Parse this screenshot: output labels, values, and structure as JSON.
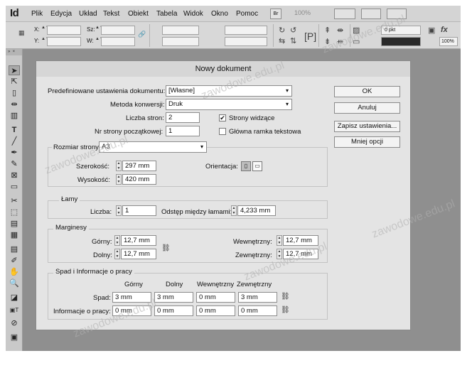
{
  "app": {
    "logo": "Id"
  },
  "menubar": {
    "items": [
      "Plik",
      "Edycja",
      "Układ",
      "Tekst",
      "Obiekt",
      "Tabela",
      "Widok",
      "Okno",
      "Pomoc"
    ],
    "bridge_label": "Br",
    "zoom": "100%"
  },
  "controlbar": {
    "x_label": "X:",
    "y_label": "Y:",
    "w_label": "Sz:",
    "h_label": "W:",
    "stroke_weight": "0 pkt",
    "zoom_pct": "100%"
  },
  "dialog": {
    "title": "Nowy dokument",
    "preset_label": "Predefiniowane ustawienia dokumentu:",
    "preset_value": "[Własne]",
    "intent_label": "Metoda konwersji:",
    "intent_value": "Druk",
    "pages_label": "Liczba stron:",
    "pages_value": "2",
    "start_label": "Nr strony początkowej:",
    "start_value": "1",
    "facing_label": "Strony widzące",
    "facing_checked": true,
    "master_label": "Główna ramka tekstowa",
    "master_checked": false,
    "page_size_label": "Rozmiar strony:",
    "page_size_value": "A3",
    "width_label": "Szerokość:",
    "width_value": "297 mm",
    "height_label": "Wysokość:",
    "height_value": "420 mm",
    "orientation_label": "Orientacja:",
    "columns": {
      "title": "Łamy",
      "number_label": "Liczba:",
      "number_value": "1",
      "gutter_label": "Odstęp między łamami:",
      "gutter_value": "4,233 mm"
    },
    "margins": {
      "title": "Marginesy",
      "top_label": "Górny:",
      "top_value": "12,7 mm",
      "bottom_label": "Dolny:",
      "bottom_value": "12,7 mm",
      "inside_label": "Wewnętrzny:",
      "inside_value": "12,7 mm",
      "outside_label": "Zewnętrzny:",
      "outside_value": "12,7 mm"
    },
    "bleed": {
      "title": "Spad i Informacje o pracy",
      "headers": [
        "Górny",
        "Dolny",
        "Wewnętrzny",
        "Zewnętrzny"
      ],
      "bleed_label": "Spad:",
      "bleed_values": [
        "3 mm",
        "3 mm",
        "0 mm",
        "3 mm"
      ],
      "slug_label": "Informacje o pracy:",
      "slug_values": [
        "0 mm",
        "0 mm",
        "0 mm",
        "0 mm"
      ]
    },
    "buttons": {
      "ok": "OK",
      "cancel": "Anuluj",
      "save_preset": "Zapisz ustawienia...",
      "fewer_options": "Mniej opcji"
    }
  },
  "watermark": "zawodowe.edu.pl",
  "colors": {
    "menubar": "#d4d4d4",
    "canvas": "#8f8f8f",
    "dialog": "#e4e4e4"
  }
}
